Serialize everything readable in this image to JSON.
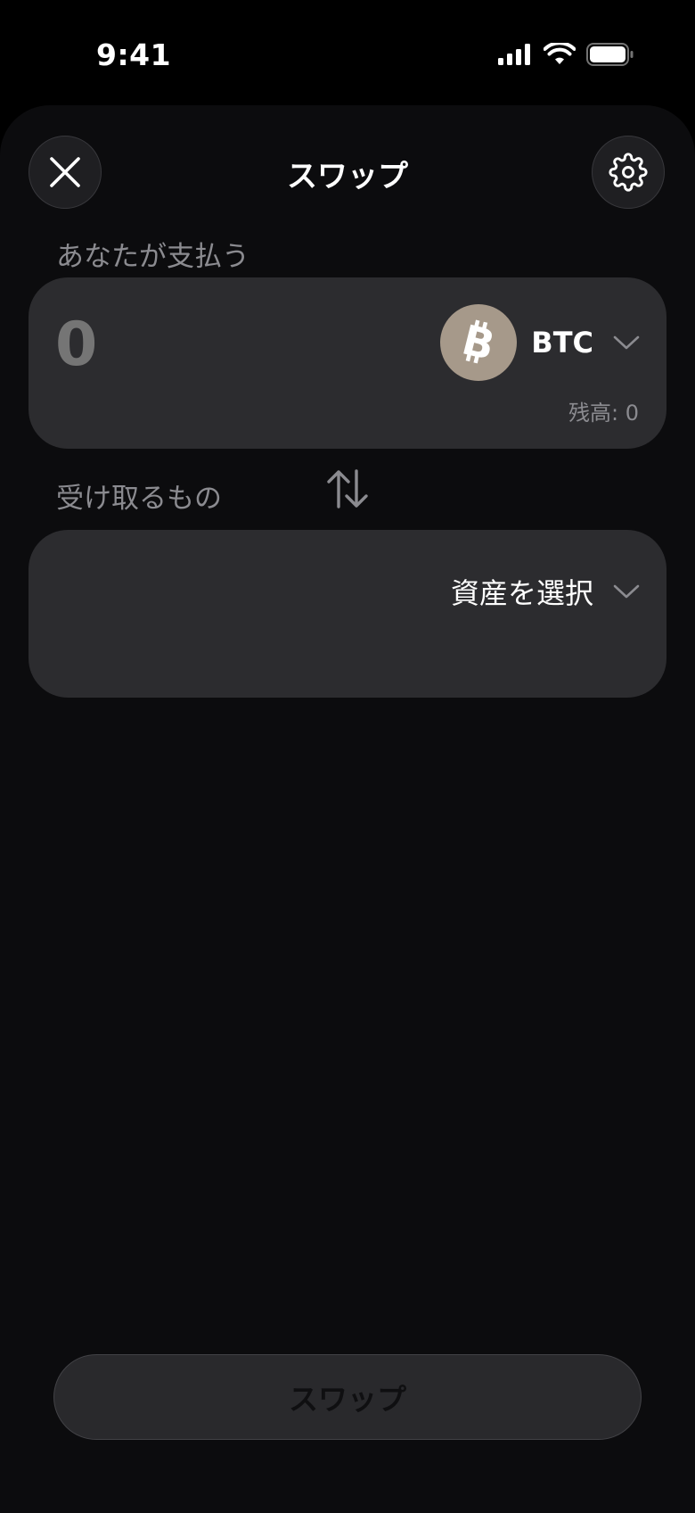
{
  "status_bar": {
    "time": "9:41"
  },
  "header": {
    "title": "スワップ",
    "close_icon": "close-icon",
    "settings_icon": "gear-icon"
  },
  "pay": {
    "label": "あなたが支払う",
    "amount_placeholder": "0",
    "token_symbol": "BTC",
    "token_icon": "bitcoin-icon",
    "balance": "残高: 0"
  },
  "receive": {
    "label": "受け取るもの",
    "select_label": "資産を選択"
  },
  "swap_direction_icon": "swap-vertical-icon",
  "footer": {
    "swap_button_label": "スワップ"
  },
  "colors": {
    "background": "#0c0c0e",
    "card": "#2c2c2f",
    "muted_text": "#8b8b90",
    "btc_logo": "#a6998a"
  }
}
